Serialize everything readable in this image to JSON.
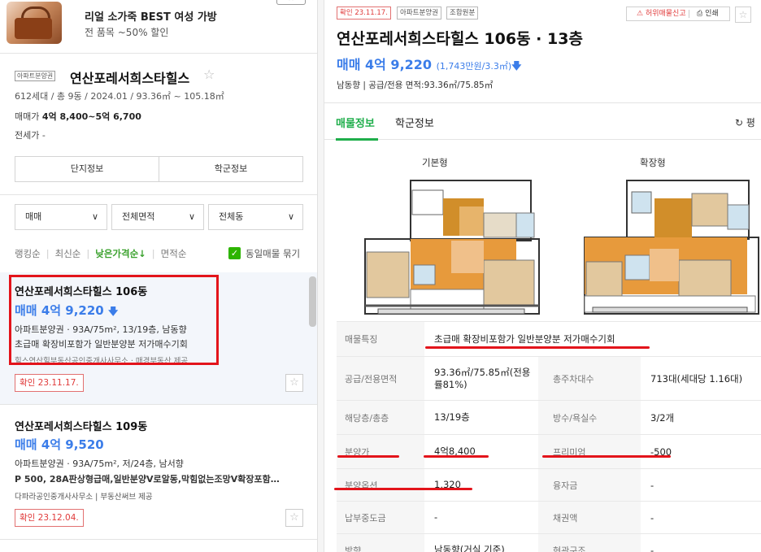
{
  "ad": {
    "title": "리얼 소가죽 BEST 여성 가방",
    "subtitle": "전 품목 ~50% 할인"
  },
  "complex": {
    "type_tag": "아파트분양권",
    "name": "연산포레서희스타힐스",
    "star": "☆",
    "meta": "612세대 / 총 9동 / 2024.01 / 93.36㎡ ~ 105.18㎡",
    "sale_label": "매매가",
    "sale_range": "4억 8,400~5억 6,700",
    "jeonse": "전세가 -",
    "buttons": [
      "단지정보",
      "학군정보"
    ]
  },
  "filters": {
    "trade": "매매",
    "area": "전체면적",
    "dong": "전체동"
  },
  "sort": {
    "options": [
      "랭킹순",
      "최신순",
      "낮은가격순↓",
      "면적순"
    ],
    "active_index": 2,
    "group_check_label": "동일매물 묶기"
  },
  "listings": [
    {
      "title": "연산포레서희스타힐스 106동",
      "price": "매매 4억 9,220",
      "price_arrow": "🡇",
      "spec": "아파트분양권 · 93A/75m², 13/19층, 남동향",
      "desc": "초급매 확장비포함가 일반분양분 저가매수기회",
      "agent": "힐스연산힐부동산공인중개사사무소 · 매경부동산 제공",
      "confirm": "확인 23.11.17."
    },
    {
      "title": "연산포레서희스타힐스 109동",
      "price": "매매 4억 9,520",
      "price_arrow": "",
      "spec": "아파트분양권 · 93A/75m², 저/24층, 남서향",
      "desc": "P 500, 28A판상형급매,일반분양V로알동,막힘없는조망V확장포함…",
      "agent": "다파라공인중개사사무소 | 부동산써브 제공",
      "confirm": "확인 23.12.04."
    }
  ],
  "detail": {
    "tags": [
      "확인 23.11.17.",
      "아파트분양권",
      "조합원분"
    ],
    "report": "허위매물신고",
    "print": "인쇄",
    "title": "연산포레서희스타힐스 106동 · 13층",
    "price": "매매 4억 9,220",
    "price_per": "(1,743만원/3.3㎡)",
    "price_arrow": "🡇",
    "spec": "남동향 | 공급/전용 면적:93.36㎡/75.85㎡",
    "tabs": [
      "매물정보",
      "학군정보"
    ],
    "refresh": "평",
    "floorplan_labels": [
      "기본형",
      "확장형"
    ],
    "table": [
      {
        "k1": "매물특징",
        "v1": "초급매 확장비포함가 일반분양분 저가매수기회",
        "k2": "",
        "v2": ""
      },
      {
        "k1": "공급/전용면적",
        "v1": "93.36㎡/75.85㎡(전용률81%)",
        "k2": "총주차대수",
        "v2": "713대(세대당 1.16대)"
      },
      {
        "k1": "해당층/총층",
        "v1": "13/19층",
        "k2": "방수/욕실수",
        "v2": "3/2개"
      },
      {
        "k1": "분양가",
        "v1": "4억8,400",
        "k2": "프리미엄",
        "v2": "-500"
      },
      {
        "k1": "분양옵션",
        "v1": "1,320",
        "k2": "융자금",
        "v2": "-"
      },
      {
        "k1": "납부중도금",
        "v1": "-",
        "k2": "채권액",
        "v2": "-"
      },
      {
        "k1": "방향",
        "v1": "남동향(거실 기준)",
        "k2": "현관구조",
        "v2": "-"
      }
    ]
  },
  "colors": {
    "accent_green": "#1fae4b",
    "price_blue": "#3b7de9",
    "annotation_red": "#e3141b"
  }
}
